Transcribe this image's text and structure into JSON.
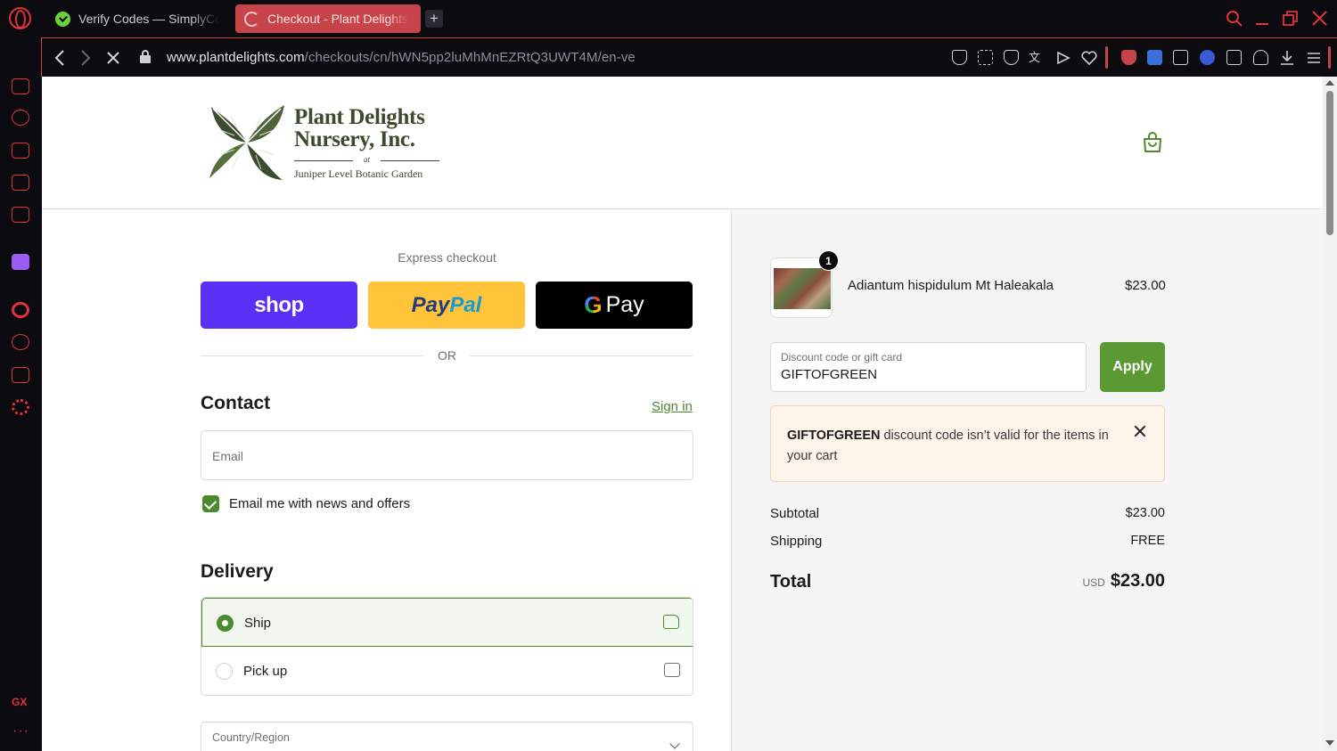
{
  "browser": {
    "tabs": [
      {
        "title": "Verify Codes — SimplyCodes"
      },
      {
        "title": "Checkout - Plant Delights"
      }
    ],
    "new_tab_label": "+",
    "url_domain": "www.plantdelights.com",
    "url_path": "/checkouts/cn/hWN5pp2luMhMnEZRtQ3UWT4M/en-ve",
    "sidebar_gx_label": "GX",
    "sidebar_more_label": "···",
    "accent_color": "#e0323d"
  },
  "header": {
    "logo_name_line1": "Plant Delights",
    "logo_name_line2": "Nursery, Inc.",
    "logo_at": "at",
    "logo_sub": "Juniper Level Botanic Garden",
    "brand_color": "#3c4a2e"
  },
  "checkout": {
    "express_label": "Express checkout",
    "shop_label": "shop",
    "paypal_part1": "Pay",
    "paypal_part2": "Pal",
    "gpay_g": "G",
    "gpay_label": "Pay",
    "or_label": "OR",
    "contact_title": "Contact",
    "signin_label": "Sign in",
    "email_placeholder": "Email",
    "news_checkbox_label": "Email me with news and offers",
    "news_checked": true,
    "delivery_title": "Delivery",
    "delivery_options": [
      {
        "label": "Ship",
        "selected": true,
        "icon": "truck-icon"
      },
      {
        "label": "Pick up",
        "selected": false,
        "icon": "store-icon"
      }
    ],
    "country_label": "Country/Region",
    "accent_green": "#4c8a2d"
  },
  "summary": {
    "product": {
      "name": "Adiantum hispidulum Mt Haleakala",
      "price": "$23.00",
      "quantity": "1"
    },
    "discount_label": "Discount code or gift card",
    "discount_value": "GIFTOFGREEN",
    "apply_label": "Apply",
    "error_code": "GIFTOFGREEN",
    "error_message": " discount code isn’t valid for the items in your cart",
    "subtotal_label": "Subtotal",
    "subtotal_value": "$23.00",
    "shipping_label": "Shipping",
    "shipping_value": "FREE",
    "total_label": "Total",
    "total_currency": "USD",
    "total_value": "$23.00"
  }
}
